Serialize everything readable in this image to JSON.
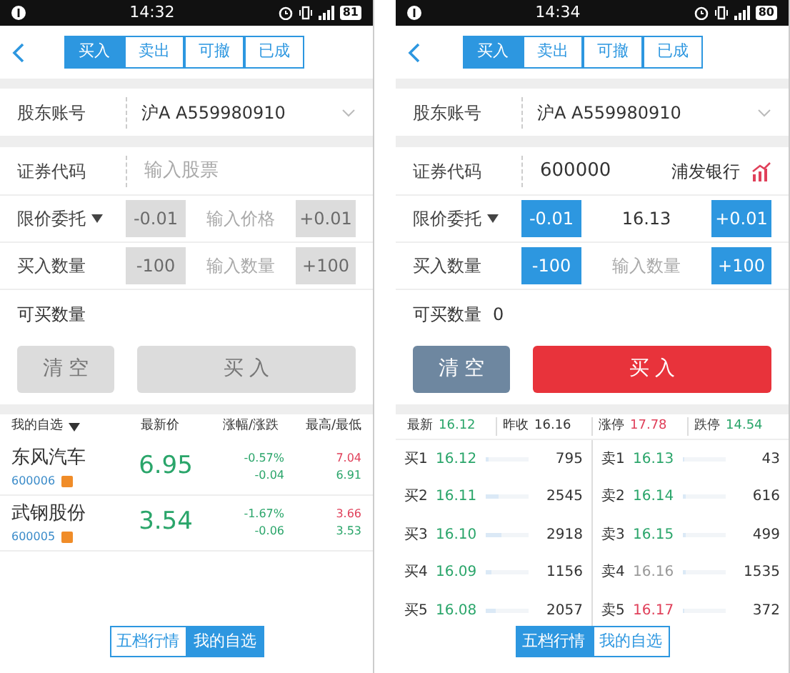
{
  "screens": [
    {
      "status": {
        "time": "14:32",
        "battery": "81"
      },
      "tabs": [
        {
          "label": "买入",
          "selected": true
        },
        {
          "label": "卖出",
          "selected": false
        },
        {
          "label": "可撤",
          "selected": false
        },
        {
          "label": "已成",
          "selected": false
        }
      ],
      "account": {
        "label": "股东账号",
        "value": "沪A A559980910"
      },
      "code": {
        "label": "证券代码",
        "placeholder": "输入股票"
      },
      "price": {
        "label": "限价委托",
        "minus": "-0.01",
        "placeholder": "输入价格",
        "plus": "+0.01",
        "enabled": false
      },
      "quantity": {
        "label": "买入数量",
        "minus": "-100",
        "placeholder": "输入数量",
        "plus": "+100",
        "enabled": false
      },
      "available": {
        "label": "可买数量"
      },
      "actions": {
        "clear": "清 空",
        "buy": "买 入",
        "enabled": false
      },
      "panel": {
        "kind": "watchlist",
        "columns": [
          "我的自选",
          "最新价",
          "涨幅/涨跌",
          "最高/最低"
        ],
        "rows": [
          {
            "name": "东风汽车",
            "code": "600006",
            "price": "6.95",
            "percent": "-0.57%",
            "change": "-0.04",
            "high": {
              "text": "7.04",
              "color": "#e0405a"
            },
            "low": {
              "text": "6.91",
              "color": "#2aa56a"
            }
          },
          {
            "name": "武钢股份",
            "code": "600005",
            "price": "3.54",
            "percent": "-1.67%",
            "change": "-0.06",
            "high": {
              "text": "3.66",
              "color": "#e0405a"
            },
            "low": {
              "text": "3.53",
              "color": "#2aa56a"
            }
          }
        ]
      },
      "toggle": [
        {
          "label": "五档行情",
          "selected": false
        },
        {
          "label": "我的自选",
          "selected": true
        }
      ]
    },
    {
      "status": {
        "time": "14:34",
        "battery": "80"
      },
      "tabs": [
        {
          "label": "买入",
          "selected": true
        },
        {
          "label": "卖出",
          "selected": false
        },
        {
          "label": "可撤",
          "selected": false
        },
        {
          "label": "已成",
          "selected": false
        }
      ],
      "account": {
        "label": "股东账号",
        "value": "沪A A559980910"
      },
      "code": {
        "label": "证券代码",
        "value": "600000",
        "stock_name": "浦发银行"
      },
      "price": {
        "label": "限价委托",
        "minus": "-0.01",
        "value": "16.13",
        "plus": "+0.01",
        "enabled": true
      },
      "quantity": {
        "label": "买入数量",
        "minus": "-100",
        "placeholder": "输入数量",
        "plus": "+100",
        "enabled": true
      },
      "available": {
        "label": "可买数量",
        "value": "0"
      },
      "actions": {
        "clear": "清 空",
        "buy": "买 入",
        "enabled": true
      },
      "panel": {
        "kind": "quote",
        "summary": [
          {
            "label": "最新",
            "value": "16.12",
            "color": "#2aa56a"
          },
          {
            "label": "昨收",
            "value": "16.16",
            "color": "#333333"
          },
          {
            "label": "涨停",
            "value": "17.78",
            "color": "#e0405a"
          },
          {
            "label": "跌停",
            "value": "14.54",
            "color": "#2aa56a"
          }
        ],
        "bids": [
          {
            "label": "买1",
            "price": "16.12",
            "volume": "795",
            "level": 0.08,
            "color": "#2aa56a"
          },
          {
            "label": "买2",
            "price": "16.11",
            "volume": "2545",
            "level": 0.3,
            "color": "#2aa56a"
          },
          {
            "label": "买3",
            "price": "16.10",
            "volume": "2918",
            "level": 0.35,
            "color": "#2aa56a"
          },
          {
            "label": "买4",
            "price": "16.09",
            "volume": "1156",
            "level": 0.12,
            "color": "#2aa56a"
          },
          {
            "label": "买5",
            "price": "16.08",
            "volume": "2057",
            "level": 0.22,
            "color": "#2aa56a"
          }
        ],
        "asks": [
          {
            "label": "卖1",
            "price": "16.13",
            "volume": "43",
            "level": 0.02,
            "color": "#2aa56a"
          },
          {
            "label": "卖2",
            "price": "16.14",
            "volume": "616",
            "level": 0.06,
            "color": "#2aa56a"
          },
          {
            "label": "卖3",
            "price": "16.15",
            "volume": "499",
            "level": 0.05,
            "color": "#2aa56a"
          },
          {
            "label": "卖4",
            "price": "16.16",
            "volume": "1535",
            "level": 0.08,
            "color": "#999999"
          },
          {
            "label": "卖5",
            "price": "16.17",
            "volume": "372",
            "level": 0.04,
            "color": "#e0405a"
          }
        ]
      },
      "toggle": [
        {
          "label": "五档行情",
          "selected": true
        },
        {
          "label": "我的自选",
          "selected": false
        }
      ]
    }
  ]
}
